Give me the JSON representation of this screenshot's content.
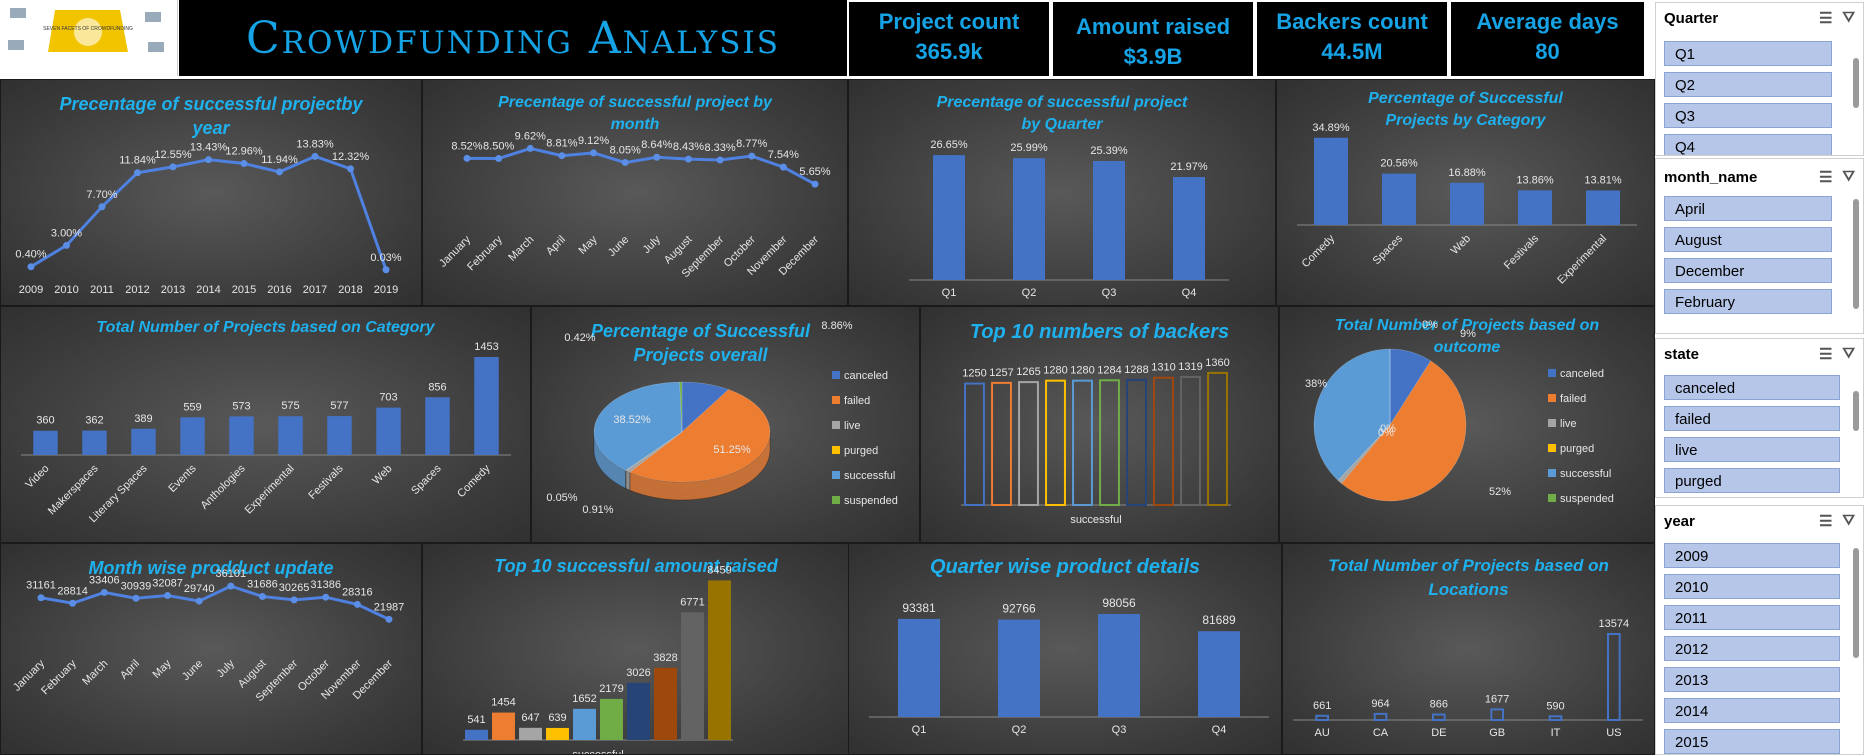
{
  "header": {
    "title": "Crowdfunding Analysis",
    "logo_caption": "SEVEN FACETS OF CROWDFUNDING",
    "kpis": [
      {
        "label": "Project count",
        "value": "365.9k"
      },
      {
        "label": "Amount raised",
        "value": "$3.9B"
      },
      {
        "label": "Backers count",
        "value": "44.5M"
      },
      {
        "label": "Average days",
        "value": "80"
      }
    ]
  },
  "slicers": [
    {
      "title": "Quarter",
      "items": [
        "Q1",
        "Q2",
        "Q3",
        "Q4"
      ]
    },
    {
      "title": "month_name",
      "items": [
        "April",
        "August",
        "December",
        "February"
      ]
    },
    {
      "title": "state",
      "items": [
        "canceled",
        "failed",
        "live",
        "purged"
      ]
    },
    {
      "title": "year",
      "items": [
        "2009",
        "2010",
        "2011",
        "2012",
        "2013",
        "2014",
        "2015"
      ]
    }
  ],
  "colors": {
    "accent": "#1fb1ee",
    "bar": "#4472c4",
    "orange": "#ed7d31",
    "gray": "#a5a5a5",
    "gold": "#ffc000",
    "lightblue": "#5b9bd5",
    "green": "#70ad47",
    "panel": "#3a3a3a"
  },
  "chart_data": [
    {
      "id": "by_year",
      "type": "line",
      "title": "Precentage of successful projectby year",
      "categories": [
        "2009",
        "2010",
        "2011",
        "2012",
        "2013",
        "2014",
        "2015",
        "2016",
        "2017",
        "2018",
        "2019"
      ],
      "values": [
        0.4,
        3.0,
        7.7,
        11.84,
        12.55,
        13.43,
        12.96,
        11.94,
        13.83,
        12.32,
        0.03
      ],
      "labels": [
        "0.40%",
        "3.00%",
        "7.70%",
        "11.84%",
        "12.55%",
        "13.43%",
        "12.96%",
        "11.94%",
        "13.83%",
        "12.32%",
        "0.03%"
      ]
    },
    {
      "id": "by_month",
      "type": "line",
      "title": "Precentage of successful project by month",
      "categories": [
        "January",
        "February",
        "March",
        "April",
        "May",
        "June",
        "July",
        "August",
        "September",
        "October",
        "November",
        "December"
      ],
      "values": [
        8.52,
        8.5,
        9.62,
        8.81,
        9.12,
        8.05,
        8.64,
        8.43,
        8.33,
        8.77,
        7.54,
        5.65
      ],
      "labels": [
        "8.52%",
        "8.50%",
        "9.62%",
        "8.81%",
        "9.12%",
        "8.05%",
        "8.64%",
        "8.43%",
        "8.33%",
        "8.77%",
        "7.54%",
        "5.65%"
      ]
    },
    {
      "id": "by_quarter",
      "type": "bar",
      "title": "Precentage of successful project by Quarter",
      "categories": [
        "Q1",
        "Q2",
        "Q3",
        "Q4"
      ],
      "values": [
        26.65,
        25.99,
        25.39,
        21.97
      ],
      "labels": [
        "26.65%",
        "25.99%",
        "25.39%",
        "21.97%"
      ]
    },
    {
      "id": "by_category_pct",
      "type": "bar",
      "title": "Percentage of Successful Projects  by Category",
      "categories": [
        "Comedy",
        "Spaces",
        "Web",
        "Festivals",
        "Experimental"
      ],
      "values": [
        34.89,
        20.56,
        16.88,
        13.86,
        13.81
      ],
      "labels": [
        "34.89%",
        "20.56%",
        "16.88%",
        "13.86%",
        "13.81%"
      ]
    },
    {
      "id": "category_count",
      "type": "bar",
      "title": "Total Number of Projects based on  Category",
      "categories": [
        "Video",
        "Makerspaces",
        "Literary Spaces",
        "Events",
        "Anthologies",
        "Experimental",
        "Festivals",
        "Web",
        "Spaces",
        "Comedy"
      ],
      "values": [
        360,
        362,
        389,
        559,
        573,
        575,
        577,
        703,
        856,
        1453
      ]
    },
    {
      "id": "overall_pie",
      "type": "pie",
      "title": "Percentage of Successful Projects overall",
      "categories": [
        "canceled",
        "failed",
        "live",
        "purged",
        "successful",
        "suspended"
      ],
      "values": [
        8.86,
        51.25,
        0.91,
        0.05,
        38.52,
        0.42
      ],
      "labels": [
        "8.86%",
        "51.25%",
        "0.91%",
        "0.05%",
        "38.52%",
        "0.42%"
      ]
    },
    {
      "id": "top_backers",
      "type": "bar",
      "title": "Top 10 numbers of backers",
      "xlabel": "successful",
      "values": [
        1250,
        1257,
        1265,
        1280,
        1280,
        1284,
        1288,
        1310,
        1319,
        1360
      ]
    },
    {
      "id": "outcome_pie",
      "type": "pie",
      "title": "Total Number of Projects based on outcome",
      "categories": [
        "canceled",
        "failed",
        "live",
        "purged",
        "successful",
        "suspended"
      ],
      "values": [
        9,
        52,
        1,
        0,
        38,
        0
      ],
      "labels": [
        "9%",
        "52%",
        "0%",
        "0%",
        "38%",
        "0%"
      ]
    },
    {
      "id": "month_update",
      "type": "line",
      "title": "Month wise prodduct update",
      "categories": [
        "January",
        "February",
        "March",
        "April",
        "May",
        "June",
        "July",
        "August",
        "September",
        "October",
        "November",
        "December"
      ],
      "values": [
        31161,
        28814,
        33406,
        30939,
        32087,
        29740,
        36101,
        31686,
        30265,
        31386,
        28316,
        21987
      ]
    },
    {
      "id": "top_amount",
      "type": "bar",
      "title": "Top 10 successful amount raised",
      "xlabel": "successful",
      "values": [
        541,
        1454,
        647,
        639,
        1652,
        2179,
        3026,
        3828,
        6771,
        8459
      ]
    },
    {
      "id": "quarter_details",
      "type": "bar",
      "title": "Quarter wise product details",
      "categories": [
        "Q1",
        "Q2",
        "Q3",
        "Q4"
      ],
      "values": [
        93381,
        92766,
        98056,
        81689
      ]
    },
    {
      "id": "locations",
      "type": "bar",
      "title": "Total Number of Projects based on Locations",
      "categories": [
        "AU",
        "CA",
        "DE",
        "GB",
        "IT",
        "US"
      ],
      "values": [
        661,
        964,
        866,
        1677,
        590,
        13574
      ]
    }
  ]
}
